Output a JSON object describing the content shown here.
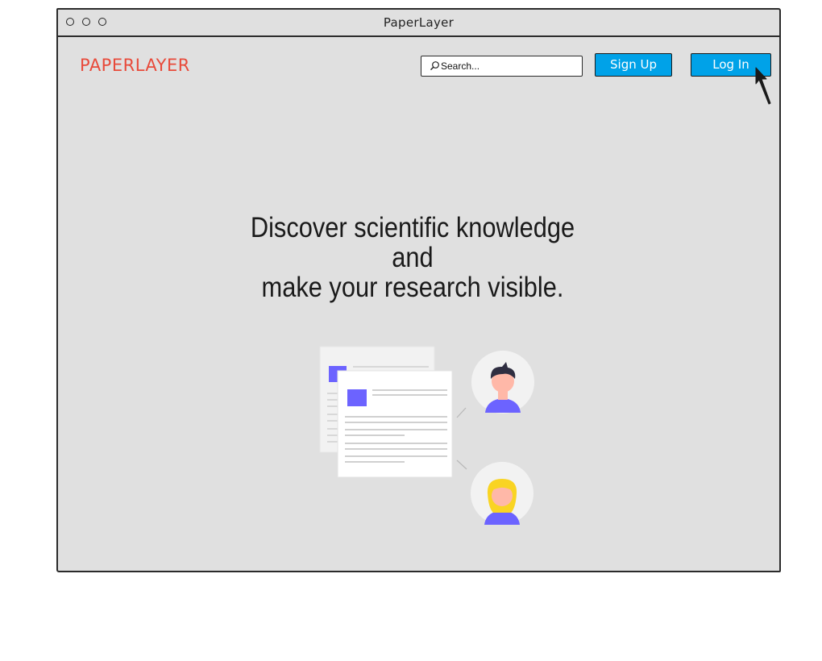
{
  "window": {
    "title": "PaperLayer"
  },
  "header": {
    "logo": "PAPERLAYER",
    "search": {
      "placeholder": "Search...",
      "value": ""
    },
    "signup_label": "Sign Up",
    "login_label": "Log In"
  },
  "hero": {
    "line1": "Discover scientific knowledge",
    "line2": "and",
    "line3": "make your research visible."
  },
  "colors": {
    "accent": "#00a2e8",
    "logo": "#e84a3a",
    "background": "#e0e0e0",
    "illustration_accent": "#6c63ff"
  },
  "icons": [
    "window-dot-icon",
    "search-icon",
    "mouse-cursor-icon",
    "document-icon",
    "user-avatar-icon"
  ]
}
